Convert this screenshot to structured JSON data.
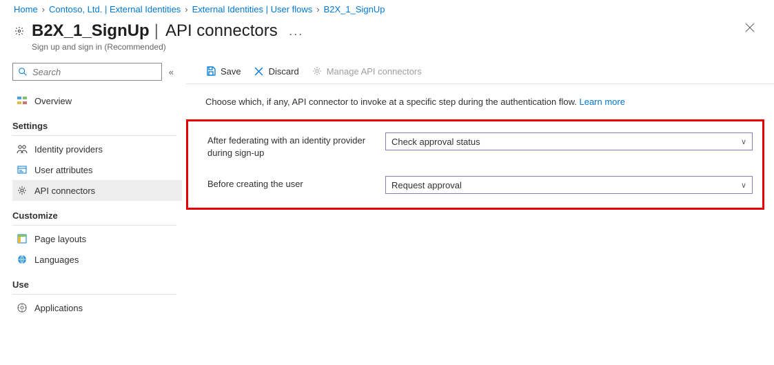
{
  "breadcrumb": [
    {
      "label": "Home"
    },
    {
      "label": "Contoso, Ltd. | External Identities"
    },
    {
      "label": "External Identities | User flows"
    },
    {
      "label": "B2X_1_SignUp"
    }
  ],
  "header": {
    "title_bold": "B2X_1_SignUp",
    "title_light": "API connectors",
    "subtitle": "Sign up and sign in (Recommended)"
  },
  "search": {
    "placeholder": "Search"
  },
  "sidebar": {
    "overview": "Overview",
    "sections": {
      "settings": {
        "label": "Settings",
        "items": [
          {
            "label": "Identity providers"
          },
          {
            "label": "User attributes"
          },
          {
            "label": "API connectors",
            "active": true
          }
        ]
      },
      "customize": {
        "label": "Customize",
        "items": [
          {
            "label": "Page layouts"
          },
          {
            "label": "Languages"
          }
        ]
      },
      "use": {
        "label": "Use",
        "items": [
          {
            "label": "Applications"
          }
        ]
      }
    }
  },
  "toolbar": {
    "save": "Save",
    "discard": "Discard",
    "manage": "Manage API connectors"
  },
  "main": {
    "description": "Choose which, if any, API connector to invoke at a specific step during the authentication flow.",
    "learn_more": "Learn more",
    "rows": [
      {
        "label": "After federating with an identity provider during sign-up",
        "value": "Check approval status"
      },
      {
        "label": "Before creating the user",
        "value": "Request approval"
      }
    ]
  }
}
